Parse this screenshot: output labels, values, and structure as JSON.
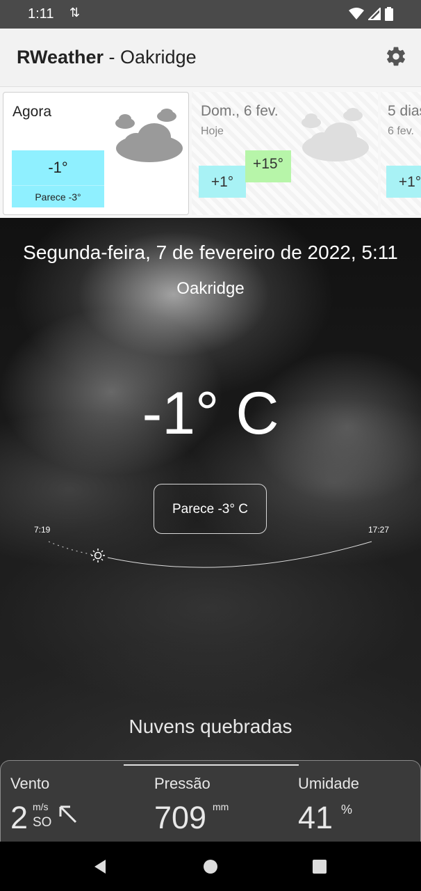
{
  "status_bar": {
    "time": "1:11",
    "sync_icon": "sync-arrows-icon",
    "icons": [
      "wifi-icon",
      "signal-icon",
      "battery-icon"
    ]
  },
  "app_bar": {
    "app_name": "RWeather",
    "separator": " - ",
    "location": "Oakridge",
    "settings_icon": "gear-icon"
  },
  "forecast": {
    "now": {
      "label": "Agora",
      "temp": "-1°",
      "feels": "Parece -3°",
      "icon": "cloud-icon"
    },
    "day1": {
      "label": "Dom., 6 fev.",
      "sub": "Hoje",
      "min": "+1°",
      "max": "+15°",
      "icon": "cloud-icon"
    },
    "day2": {
      "label": "5 dias",
      "sub": "6 fev.",
      "min": "+1°"
    }
  },
  "main": {
    "date": "Segunda-feira, 7 de fevereiro de 2022, 5:11",
    "city": "Oakridge",
    "temp": "-1° C",
    "feels_like": "Parece  -3° C",
    "sunrise": "7:19",
    "sunset": "17:27",
    "condition": "Nuvens quebradas"
  },
  "details": {
    "wind": {
      "label": "Vento",
      "value": "2",
      "unit": "m/s",
      "dir": "SO",
      "icon": "arrow-up-left-icon"
    },
    "pressure": {
      "label": "Pressão",
      "value": "709",
      "unit": "mm"
    },
    "humidity": {
      "label": "Umidade",
      "value": "41",
      "unit": "%"
    }
  },
  "colors": {
    "now_temp_bg": "#8ff0ff",
    "min_bg": "#a8f2f5",
    "max_bg": "#b7f5a9"
  }
}
